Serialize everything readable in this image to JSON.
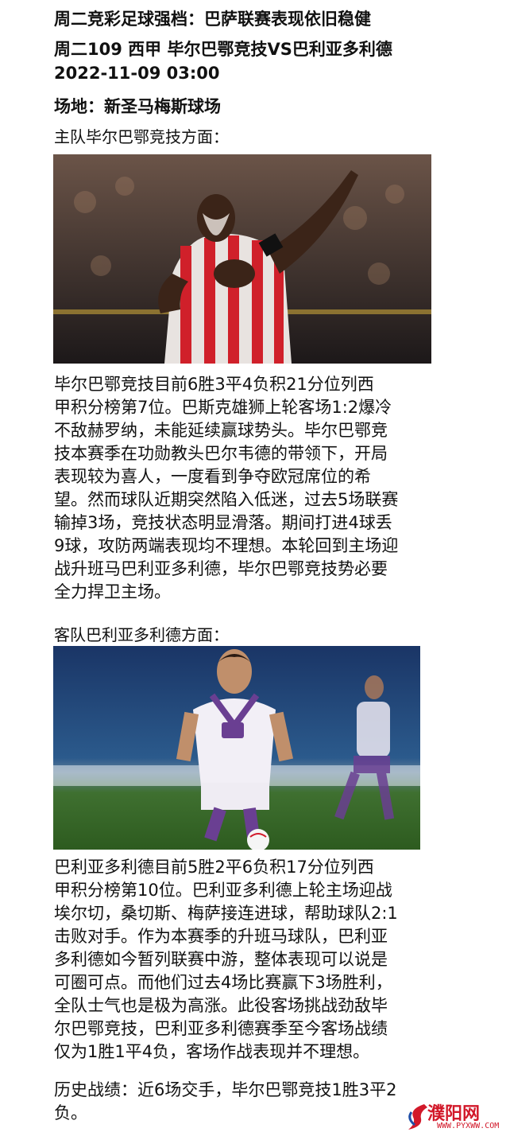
{
  "header": {
    "title": "周二竞彩足球强档：巴萨联赛表现依旧稳健",
    "match_line": "周二109 西甲 毕尔巴鄂竞技VS巴利亚多利德",
    "datetime": "2022-11-09 03:00",
    "venue": "场地：新圣马梅斯球场"
  },
  "home": {
    "heading": "主队毕尔巴鄂竞技方面：",
    "paragraph_lines": [
      "    毕尔巴鄂竞技目前6胜3平4负积21分位列西",
      "甲积分榜第7位。巴斯克雄狮上轮客场1:2爆冷",
      "不敌赫罗纳，未能延续赢球势头。毕尔巴鄂竞",
      "技本赛季在功勋教头巴尔韦德的带领下，开局",
      "表现较为喜人，一度看到争夺欧冠席位的希",
      "望。然而球队近期突然陷入低迷，过去5场联赛",
      "输掉3场，竞技状态明显滑落。期间打进4球丢",
      "9球，攻防两端表现均不理想。本轮回到主场迎",
      "战升班马巴利亚多利德，毕尔巴鄂竞技势必要",
      "全力捍卫主场。"
    ]
  },
  "away": {
    "heading": "客队巴利亚多利德方面：",
    "paragraph_lines": [
      "    巴利亚多利德目前5胜2平6负积17分位列西",
      "甲积分榜第10位。巴利亚多利德上轮主场迎战",
      "埃尔切，桑切斯、梅萨接连进球，帮助球队2:1",
      "击败对手。作为本赛季的升班马球队，巴利亚",
      "多利德如今暂列联赛中游，整体表现可以说是",
      "可圈可点。而他们过去4场比赛赢下3场胜利，",
      "全队士气也是极为高涨。此役客场挑战劲敌毕",
      "尔巴鄂竞技，巴利亚多利德赛季至今客场战绩",
      "仅为1胜1平4负，客场作战表现并不理想。"
    ]
  },
  "history": {
    "lines": [
      "历史战绩：近6场交手，毕尔巴鄂竞技1胜3平2",
      "负。"
    ]
  },
  "watermark": {
    "name": "濮阳网",
    "url": "WWW.PYXWW.COM",
    "color": "#d2192a"
  },
  "photos": [
    {
      "icon": "player-photo-athletic-bilbao"
    },
    {
      "icon": "player-photo-real-valladolid"
    }
  ]
}
